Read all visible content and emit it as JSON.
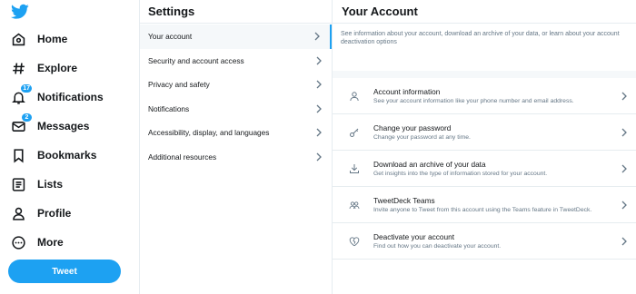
{
  "nav": {
    "items": [
      {
        "label": "Home"
      },
      {
        "label": "Explore"
      },
      {
        "label": "Notifications",
        "badge": "17"
      },
      {
        "label": "Messages",
        "badge": "2"
      },
      {
        "label": "Bookmarks"
      },
      {
        "label": "Lists"
      },
      {
        "label": "Profile"
      },
      {
        "label": "More"
      }
    ],
    "tweet_button": "Tweet"
  },
  "settings": {
    "title": "Settings",
    "items": [
      {
        "label": "Your account"
      },
      {
        "label": "Security and account access"
      },
      {
        "label": "Privacy and safety"
      },
      {
        "label": "Notifications"
      },
      {
        "label": "Accessibility, display, and languages"
      },
      {
        "label": "Additional resources"
      }
    ]
  },
  "account": {
    "title": "Your Account",
    "intro": "See information about your account, download an archive of your data, or learn about your account deactivation options",
    "items": [
      {
        "title": "Account information",
        "subtitle": "See your account information like your phone number and email address."
      },
      {
        "title": "Change your password",
        "subtitle": "Change your password at any time."
      },
      {
        "title": "Download an archive of your data",
        "subtitle": "Get insights into the type of information stored for your account."
      },
      {
        "title": "TweetDeck Teams",
        "subtitle": "Invite anyone to Tweet from this account using the Teams feature in TweetDeck."
      },
      {
        "title": "Deactivate your account",
        "subtitle": "Find out how you can deactivate your account."
      }
    ]
  },
  "colors": {
    "accent": "#1da1f2",
    "text": "#14171a",
    "muted": "#657786",
    "border": "#e6ecf0"
  }
}
